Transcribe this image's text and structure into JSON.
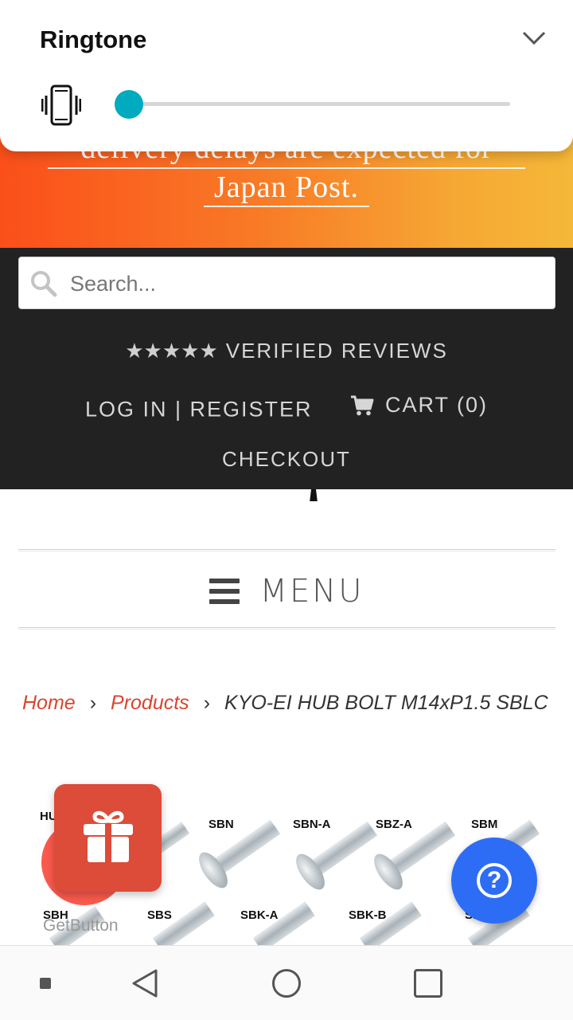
{
  "banner": {
    "line1": "delivery delays are expected for",
    "line2": "Japan Post."
  },
  "header": {
    "search_placeholder": "Search...",
    "reviews_stars": "★★★★★",
    "reviews_label": "VERIFIED REVIEWS",
    "login_label": "LOG IN | REGISTER",
    "cart_label": "CART (0)",
    "checkout_label": "CHECKOUT"
  },
  "nav": {
    "menu_label": "MENU"
  },
  "breadcrumb": {
    "home": "Home",
    "products": "Products",
    "current": "KYO-EI HUB BOLT M14xP1.5 SBLC",
    "separator": "›"
  },
  "product_image": {
    "labels_row1": [
      "HUB",
      "SBN",
      "SBN-A",
      "SBZ-A",
      "SBM"
    ],
    "labels_row2": [
      "SBH",
      "SBS",
      "SBK-A",
      "SBK-B",
      "SB"
    ]
  },
  "floating": {
    "getbutton_text": "GetButton",
    "help_symbol": "?"
  },
  "volume_panel": {
    "title": "Ringtone",
    "level": 0
  },
  "colors": {
    "accent_link": "#d9452f",
    "header_bg": "#222222",
    "gift_bg": "#dd4b39",
    "help_bg": "#2d6df6",
    "slider": "#00aabf"
  }
}
